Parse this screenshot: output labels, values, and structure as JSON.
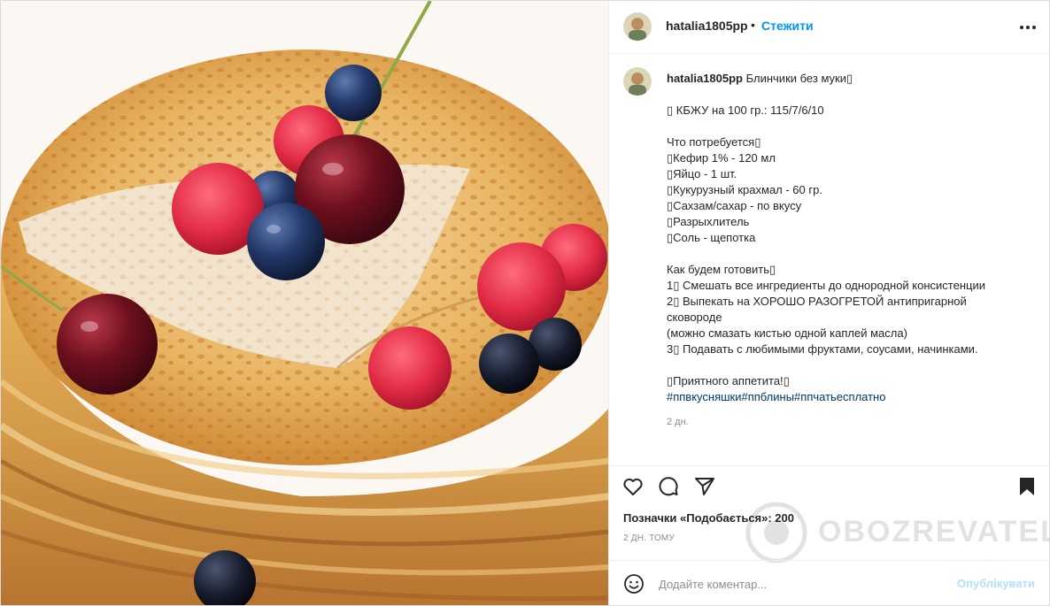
{
  "post": {
    "username": "hatalia1805pp",
    "separator": "•",
    "follow_label": "Стежити",
    "more_icon": "more-horizontal-icon"
  },
  "caption": {
    "username": "hatalia1805pp",
    "title": "Блинчики без муки",
    "lines": [
      "",
      "▯ КБЖУ на 100 гр.: 115/7/6/10",
      "",
      "Что потребуется▯",
      "▯Кефир 1% - 120 мл",
      "▯Яйцо - 1 шт.",
      "▯Кукурузный крахмал - 60 гр.",
      "▯Сахзам/сахар - по вкусу",
      "▯Разрыхлитель",
      "▯Соль - щепотка",
      "",
      "Как будем готовить▯",
      "1▯ Смешать все ингредиенты до однородной консистенции",
      "2▯ Выпекать на ХОРОШО РАЗОГРЕТОЙ антипригарной",
      "сковороде",
      "(можно смазать кистью одной каплей масла)",
      "3▯ Подавать с любимыми фруктами, соусами, начинками.",
      "",
      "▯Приятного аппетита!▯"
    ],
    "title_emoji": "▯",
    "hashtags": [
      "#ппвкусняшки",
      "#ппблины",
      "#ппчатьесплатно"
    ],
    "time": "2 дн."
  },
  "actions": {
    "like_icon": "heart-icon",
    "comment_icon": "comment-icon",
    "share_icon": "send-icon",
    "save_icon": "bookmark-icon"
  },
  "likes_text": "Позначки «Подобається»: 200",
  "posted_ago": "2 ДН. ТОМУ",
  "comment": {
    "emoji_icon": "smiley-icon",
    "placeholder": "Додайте коментар...",
    "publish_label": "Опублікувати"
  },
  "watermark": "OBOZREVATEL",
  "colors": {
    "accent": "#0095f6",
    "hashtag": "#00376b",
    "publish_disabled": "#b2dffc",
    "muted": "#8e8e8e",
    "text": "#262626"
  }
}
